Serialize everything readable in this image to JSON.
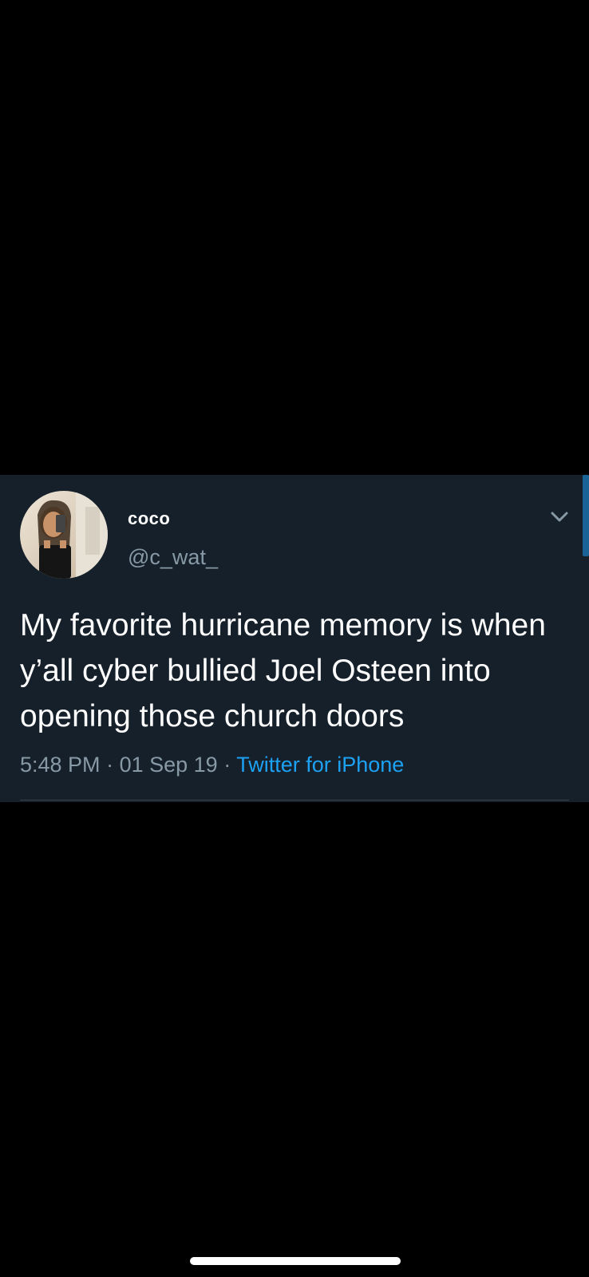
{
  "tweet": {
    "display_name": "coco",
    "handle": "@c_wat_",
    "text": "My favorite hurricane memory is when y’all cyber bullied Joel Osteen into opening those church doors",
    "time": "5:48 PM",
    "date": "01 Sep 19",
    "separator": "·",
    "source": "Twitter for iPhone"
  },
  "icons": {
    "avatar": "avatar-photo",
    "more": "chevron-down-icon"
  },
  "colors": {
    "card_background": "#15202b",
    "page_background": "#000000",
    "primary_text": "#ffffff",
    "secondary_text": "#8899a6",
    "link": "#1da1f2"
  }
}
